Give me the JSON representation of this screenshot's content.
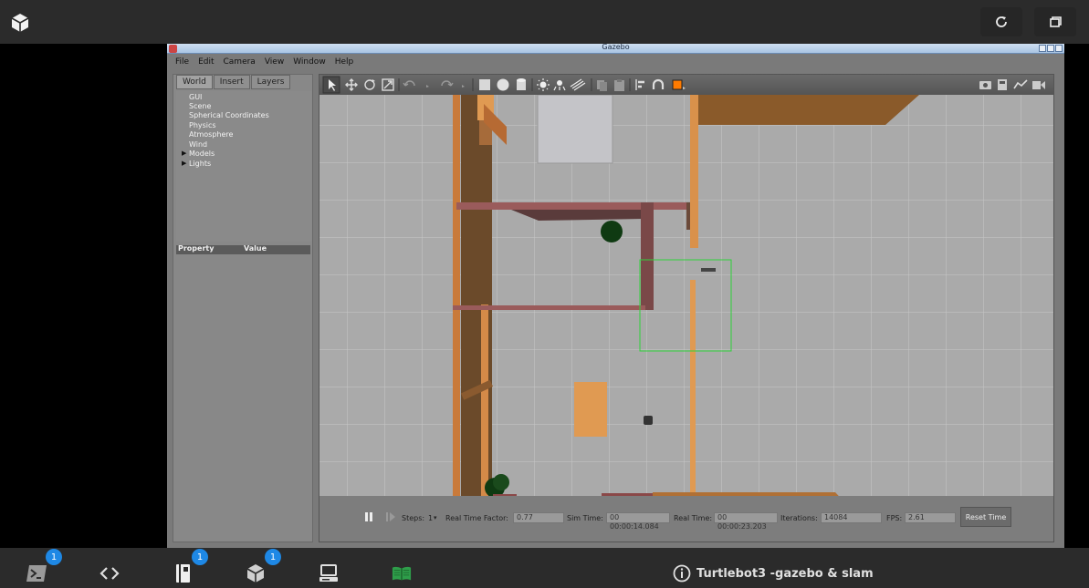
{
  "app": {
    "window_title": "Gazebo",
    "menu": [
      "File",
      "Edit",
      "Camera",
      "View",
      "Window",
      "Help"
    ]
  },
  "left_panel": {
    "tabs": [
      "World",
      "Insert",
      "Layers"
    ],
    "active_tab": "World",
    "tree": [
      {
        "label": "GUI",
        "expandable": false
      },
      {
        "label": "Scene",
        "expandable": false
      },
      {
        "label": "Spherical Coordinates",
        "expandable": false
      },
      {
        "label": "Physics",
        "expandable": false
      },
      {
        "label": "Atmosphere",
        "expandable": false
      },
      {
        "label": "Wind",
        "expandable": false
      },
      {
        "label": "Models",
        "expandable": true
      },
      {
        "label": "Lights",
        "expandable": true
      }
    ],
    "property_header": {
      "property": "Property",
      "value": "Value"
    }
  },
  "toolbar": {
    "icons": [
      "select-arrow-icon",
      "translate-icon",
      "rotate-icon",
      "scale-icon",
      "undo-icon",
      "redo-icon",
      "box-icon",
      "sphere-icon",
      "cylinder-icon",
      "point-light-icon",
      "spot-light-icon",
      "directional-light-icon",
      "copy-icon",
      "paste-icon",
      "align-icon",
      "snap-icon",
      "color-icon",
      "screenshot-icon",
      "record-log-icon",
      "plot-icon",
      "video-icon"
    ]
  },
  "bottom_bar": {
    "steps_label": "Steps:",
    "steps_value": "1",
    "rtf_label": "Real Time Factor:",
    "rtf_value": "0.77",
    "sim_time_label": "Sim Time:",
    "sim_time_value": "00 00:00:14.084",
    "real_time_label": "Real Time:",
    "real_time_value": "00 00:00:23.203",
    "iterations_label": "Iterations:",
    "iterations_value": "14084",
    "fps_label": "FPS:",
    "fps_value": "2.61",
    "reset_label": "Reset Time"
  },
  "taskbar": {
    "title": "Turtlebot3 -gazebo & slam",
    "badges": {
      "terminal": "1",
      "notebook": "1",
      "package": "1"
    }
  },
  "colors": {
    "badge": "#1e88e5",
    "accent_green": "#2e9e4a",
    "floor_grey": "#aaaaaa",
    "wood": "#d18a47",
    "brick": "#8a4848"
  }
}
